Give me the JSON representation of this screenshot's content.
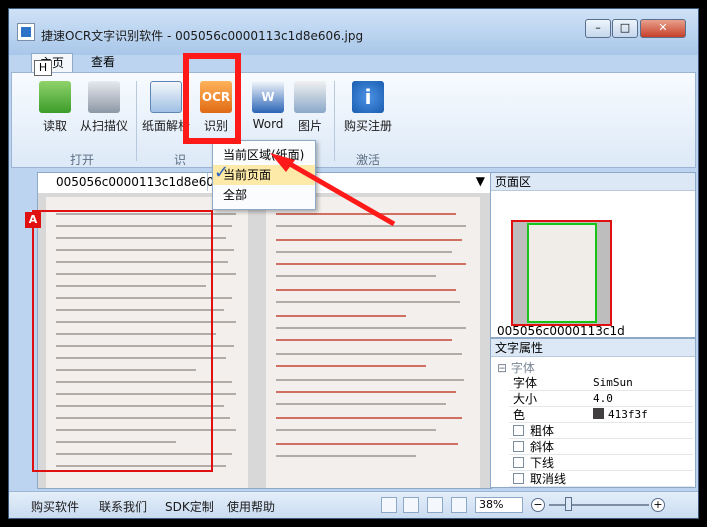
{
  "window": {
    "title": "捷速OCR文字识别软件 - 005056c0000113c1d8e606.jpg",
    "controls": {
      "minimize": "–",
      "maximize": "□",
      "close": "✕"
    }
  },
  "tabs": [
    {
      "label": "主页"
    },
    {
      "label": "查看"
    }
  ],
  "keytip": "H",
  "ribbon": {
    "read": "读取",
    "scan": "从扫描仪",
    "group_open": "打开",
    "parse": "纸面解析",
    "ocr": "识别",
    "ocr_icon_text": "OCR",
    "word": "Word",
    "word_icon_text": "W",
    "picture": "图片",
    "buy": "购买注册",
    "buy_icon_text": "i",
    "group_recognize": "识",
    "group_activate": "激活"
  },
  "ocr_menu": {
    "items": [
      "当前区域(纸面)",
      "当前页面",
      "全部"
    ],
    "checked_index": 1
  },
  "doc": {
    "tab_label": "005056c0000113c1d8e606.jpg",
    "selection_marker": "A"
  },
  "side": {
    "pages_title": "页面区",
    "thumb_label": "005056c0000113c1d",
    "props_title": "文字属性",
    "font_section": "字体",
    "props": [
      {
        "key": "字体",
        "value": "SimSun"
      },
      {
        "key": "大小",
        "value": "4.0"
      },
      {
        "key": "色",
        "value": "413f3f"
      }
    ],
    "checks": [
      "粗体",
      "斜体",
      "下线",
      "取消线"
    ]
  },
  "status": {
    "links": [
      "购买软件",
      "联系我们",
      "SDK定制",
      "使用帮助"
    ],
    "zoom": "38%",
    "zoom_minus": "−",
    "zoom_plus": "+"
  },
  "colors": {
    "highlight": "#ff1a1a",
    "selection": "#e01010",
    "thumb_frame": "#19c419",
    "text_color": "#413f3f"
  }
}
